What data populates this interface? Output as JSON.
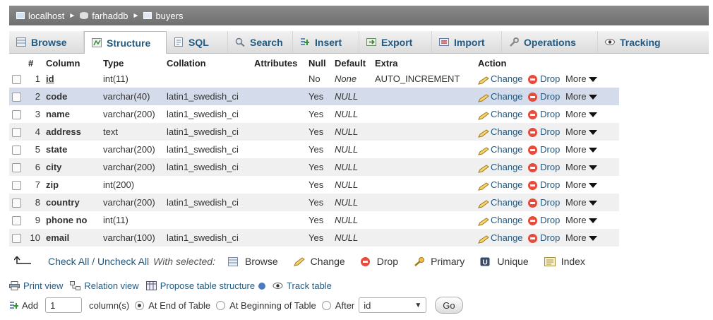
{
  "breadcrumb": {
    "server": "localhost",
    "database": "farhaddb",
    "table": "buyers"
  },
  "tabs": [
    {
      "label": "Browse",
      "icon": "browse-icon"
    },
    {
      "label": "Structure",
      "icon": "structure-icon"
    },
    {
      "label": "SQL",
      "icon": "sql-icon"
    },
    {
      "label": "Search",
      "icon": "search-icon"
    },
    {
      "label": "Insert",
      "icon": "insert-icon"
    },
    {
      "label": "Export",
      "icon": "export-icon"
    },
    {
      "label": "Import",
      "icon": "import-icon"
    },
    {
      "label": "Operations",
      "icon": "wrench-icon"
    },
    {
      "label": "Tracking",
      "icon": "eye-icon"
    }
  ],
  "active_tab": "Structure",
  "table": {
    "headers": [
      "#",
      "Column",
      "Type",
      "Collation",
      "Attributes",
      "Null",
      "Default",
      "Extra",
      "Action"
    ],
    "rows": [
      {
        "num": "1",
        "name": "id",
        "type": "int(11)",
        "collation": "",
        "attributes": "",
        "null": "No",
        "default": "None",
        "extra": "AUTO_INCREMENT"
      },
      {
        "num": "2",
        "name": "code",
        "type": "varchar(40)",
        "collation": "latin1_swedish_ci",
        "attributes": "",
        "null": "Yes",
        "default": "NULL",
        "extra": ""
      },
      {
        "num": "3",
        "name": "name",
        "type": "varchar(200)",
        "collation": "latin1_swedish_ci",
        "attributes": "",
        "null": "Yes",
        "default": "NULL",
        "extra": ""
      },
      {
        "num": "4",
        "name": "address",
        "type": "text",
        "collation": "latin1_swedish_ci",
        "attributes": "",
        "null": "Yes",
        "default": "NULL",
        "extra": ""
      },
      {
        "num": "5",
        "name": "state",
        "type": "varchar(200)",
        "collation": "latin1_swedish_ci",
        "attributes": "",
        "null": "Yes",
        "default": "NULL",
        "extra": ""
      },
      {
        "num": "6",
        "name": "city",
        "type": "varchar(200)",
        "collation": "latin1_swedish_ci",
        "attributes": "",
        "null": "Yes",
        "default": "NULL",
        "extra": ""
      },
      {
        "num": "7",
        "name": "zip",
        "type": "int(200)",
        "collation": "",
        "attributes": "",
        "null": "Yes",
        "default": "NULL",
        "extra": ""
      },
      {
        "num": "8",
        "name": "country",
        "type": "varchar(200)",
        "collation": "latin1_swedish_ci",
        "attributes": "",
        "null": "Yes",
        "default": "NULL",
        "extra": ""
      },
      {
        "num": "9",
        "name": "phone no",
        "type": "int(11)",
        "collation": "",
        "attributes": "",
        "null": "Yes",
        "default": "NULL",
        "extra": ""
      },
      {
        "num": "10",
        "name": "email",
        "type": "varchar(100)",
        "collation": "latin1_swedish_ci",
        "attributes": "",
        "null": "Yes",
        "default": "NULL",
        "extra": ""
      }
    ],
    "actions": {
      "change": "Change",
      "drop": "Drop",
      "more": "More"
    }
  },
  "with_selected": {
    "check_all": "Check All / Uncheck All",
    "label": "With selected:",
    "browse": "Browse",
    "change": "Change",
    "drop": "Drop",
    "primary": "Primary",
    "unique": "Unique",
    "index": "Index"
  },
  "links": {
    "print_view": "Print view",
    "relation_view": "Relation view",
    "propose": "Propose table structure",
    "track": "Track table"
  },
  "add_column": {
    "add_label": "Add",
    "count": "1",
    "columns_label": "column(s)",
    "at_end": "At End of Table",
    "at_beginning": "At Beginning of Table",
    "after": "After",
    "after_value": "id",
    "go": "Go"
  }
}
